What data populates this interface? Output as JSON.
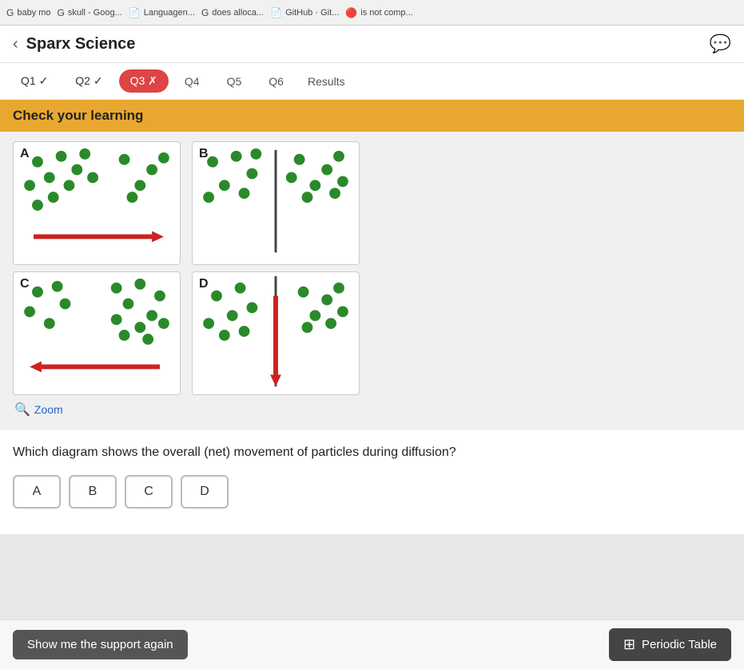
{
  "browser": {
    "tabs": [
      {
        "icon": "G",
        "label": "baby mo"
      },
      {
        "icon": "G",
        "label": "skull - Goog..."
      },
      {
        "icon": "📄",
        "label": "Languagen..."
      },
      {
        "icon": "G",
        "label": "does alloca..."
      },
      {
        "icon": "📄",
        "label": "GitHub · Git..."
      },
      {
        "icon": "🔴",
        "label": "is not comp..."
      }
    ]
  },
  "header": {
    "title": "Sparx Science",
    "back_icon": "‹",
    "chat_icon": "💬"
  },
  "tabs": [
    {
      "label": "Q1 ✓",
      "state": "correct"
    },
    {
      "label": "Q2 ✓",
      "state": "correct"
    },
    {
      "label": "Q3 ✗",
      "state": "wrong"
    },
    {
      "label": "Q4",
      "state": "plain"
    },
    {
      "label": "Q5",
      "state": "plain"
    },
    {
      "label": "Q6",
      "state": "plain"
    },
    {
      "label": "Results",
      "state": "results"
    }
  ],
  "check_banner": "Check your learning",
  "diagrams": [
    {
      "id": "A",
      "label": "A",
      "type": "arrow_right"
    },
    {
      "id": "B",
      "label": "B",
      "type": "line_vertical"
    },
    {
      "id": "C",
      "label": "C",
      "type": "arrow_left"
    },
    {
      "id": "D",
      "label": "D",
      "type": "arrow_down"
    }
  ],
  "zoom": {
    "label": "Zoom",
    "icon": "🔍"
  },
  "question": {
    "text": "Which diagram shows the overall (net) movement of particles during diffusion?"
  },
  "answers": [
    {
      "label": "A"
    },
    {
      "label": "B"
    },
    {
      "label": "C"
    },
    {
      "label": "D"
    }
  ],
  "bottom_bar": {
    "support_btn": "Show me the support again",
    "periodic_btn": "Periodic Table",
    "periodic_icon": "⊞"
  }
}
